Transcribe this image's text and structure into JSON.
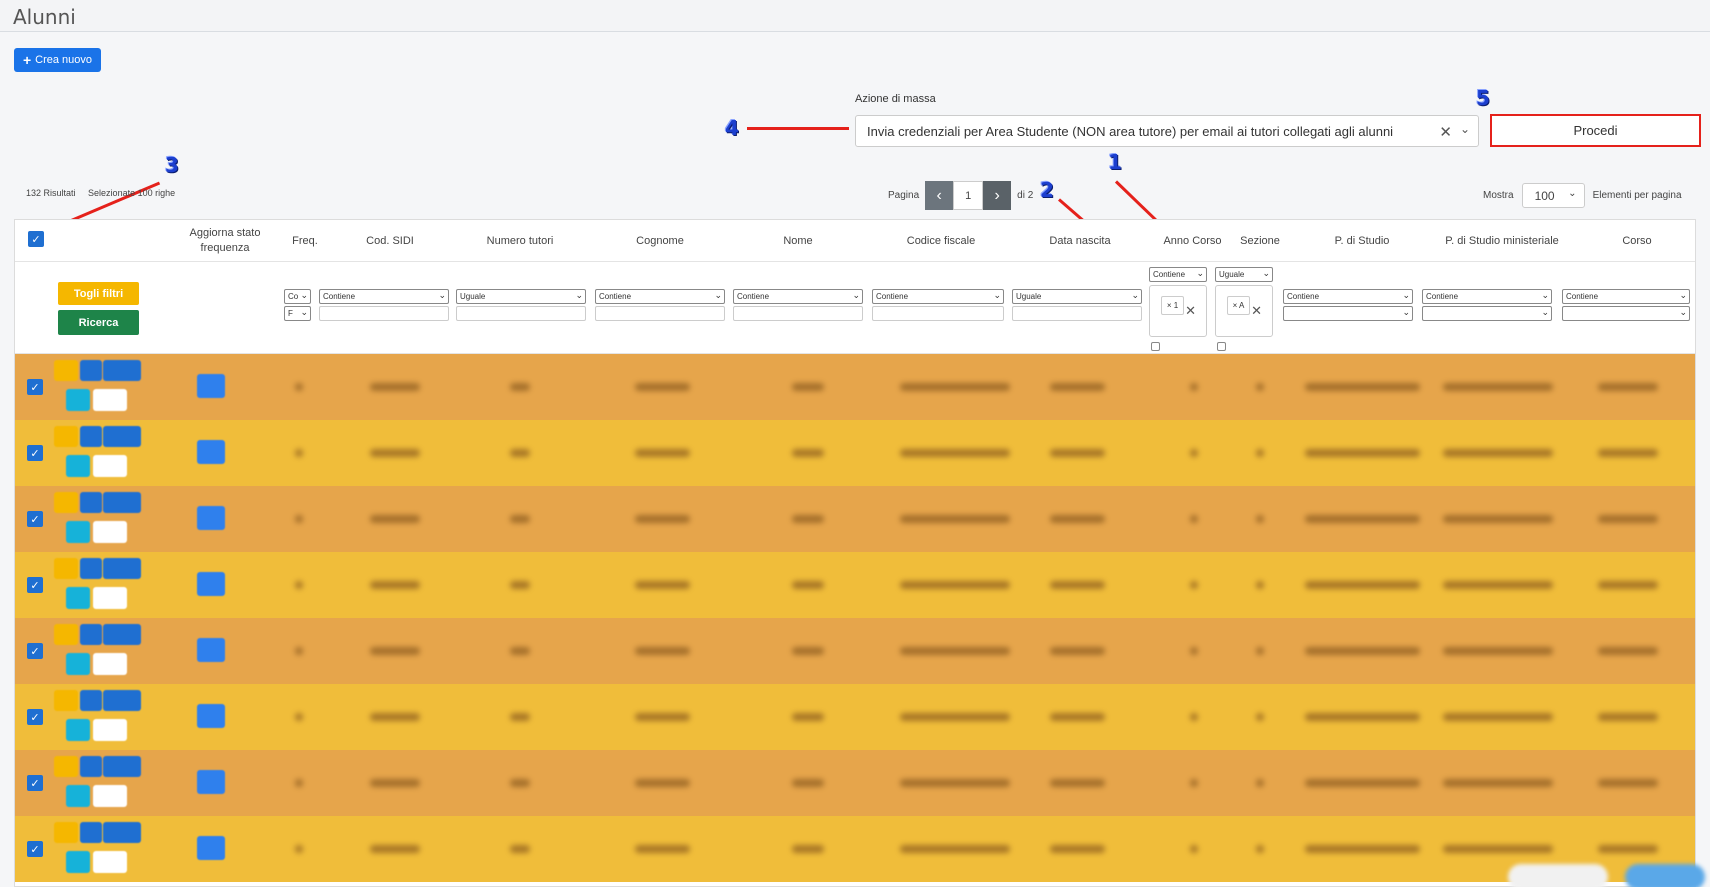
{
  "page": {
    "title": "Alunni"
  },
  "toolbar": {
    "create_label": "Crea nuovo"
  },
  "mass_action": {
    "label": "Azione di massa",
    "selected": "Invia credenziali per Area Studente (NON area tutore) per email ai tutori collegati agli alunni",
    "procedi_label": "Procedi"
  },
  "annotations": [
    "1",
    "2",
    "3",
    "4",
    "5"
  ],
  "results": {
    "count_text": "132 Risultati",
    "selected_text": "Selezionate 100 righe"
  },
  "pagination": {
    "label": "Pagina",
    "current": "1",
    "of_text": "di 2"
  },
  "page_size": {
    "label": "Mostra",
    "value": "100",
    "suffix": "Elementi per pagina"
  },
  "columns": [
    "Aggiorna stato frequenza",
    "Freq.",
    "Cod. SIDI",
    "Numero tutori",
    "Cognome",
    "Nome",
    "Codice fiscale",
    "Data nascita",
    "Anno Corso",
    "Sezione",
    "P. di Studio",
    "P. di Studio ministeriale",
    "Corso"
  ],
  "filters": {
    "togli_label": "Togli filtri",
    "ricerca_label": "Ricerca",
    "freq_op": "Co",
    "freq_val": "F",
    "contiene": "Contiene",
    "uguale": "Uguale",
    "anno_tag": "× 1",
    "sezione_tag": "× A"
  },
  "row_colors": [
    "#e6a54b",
    "#f0bd3a"
  ],
  "row_count": 8
}
